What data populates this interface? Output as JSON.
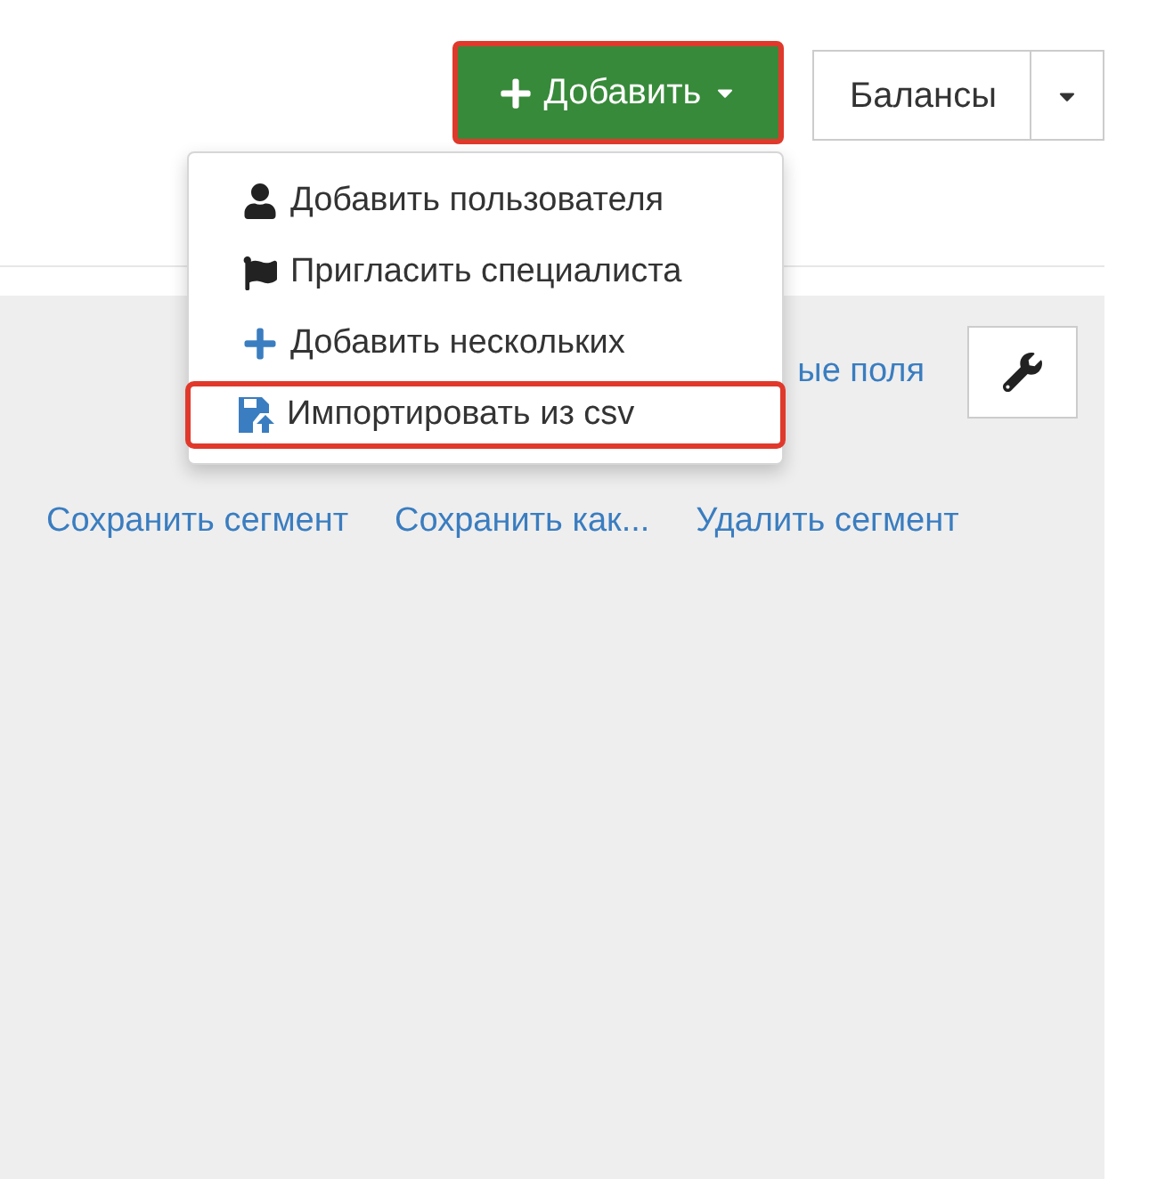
{
  "toolbar": {
    "add_button": {
      "label": "Добавить",
      "highlighted": true
    },
    "balances_button": {
      "label": "Балансы"
    }
  },
  "add_menu": {
    "items": [
      {
        "kind": "user",
        "label": "Добавить пользователя",
        "highlighted": false
      },
      {
        "kind": "flag",
        "label": "Пригласить специалиста",
        "highlighted": false
      },
      {
        "kind": "plus",
        "label": "Добавить нескольких",
        "highlighted": false
      },
      {
        "kind": "import",
        "label": "Импортировать из csv",
        "highlighted": true
      }
    ]
  },
  "panel": {
    "fields_link": "ые поля",
    "segment_links": [
      "Сохранить сегмент",
      "Сохранить как...",
      "Удалить сегмент"
    ]
  }
}
